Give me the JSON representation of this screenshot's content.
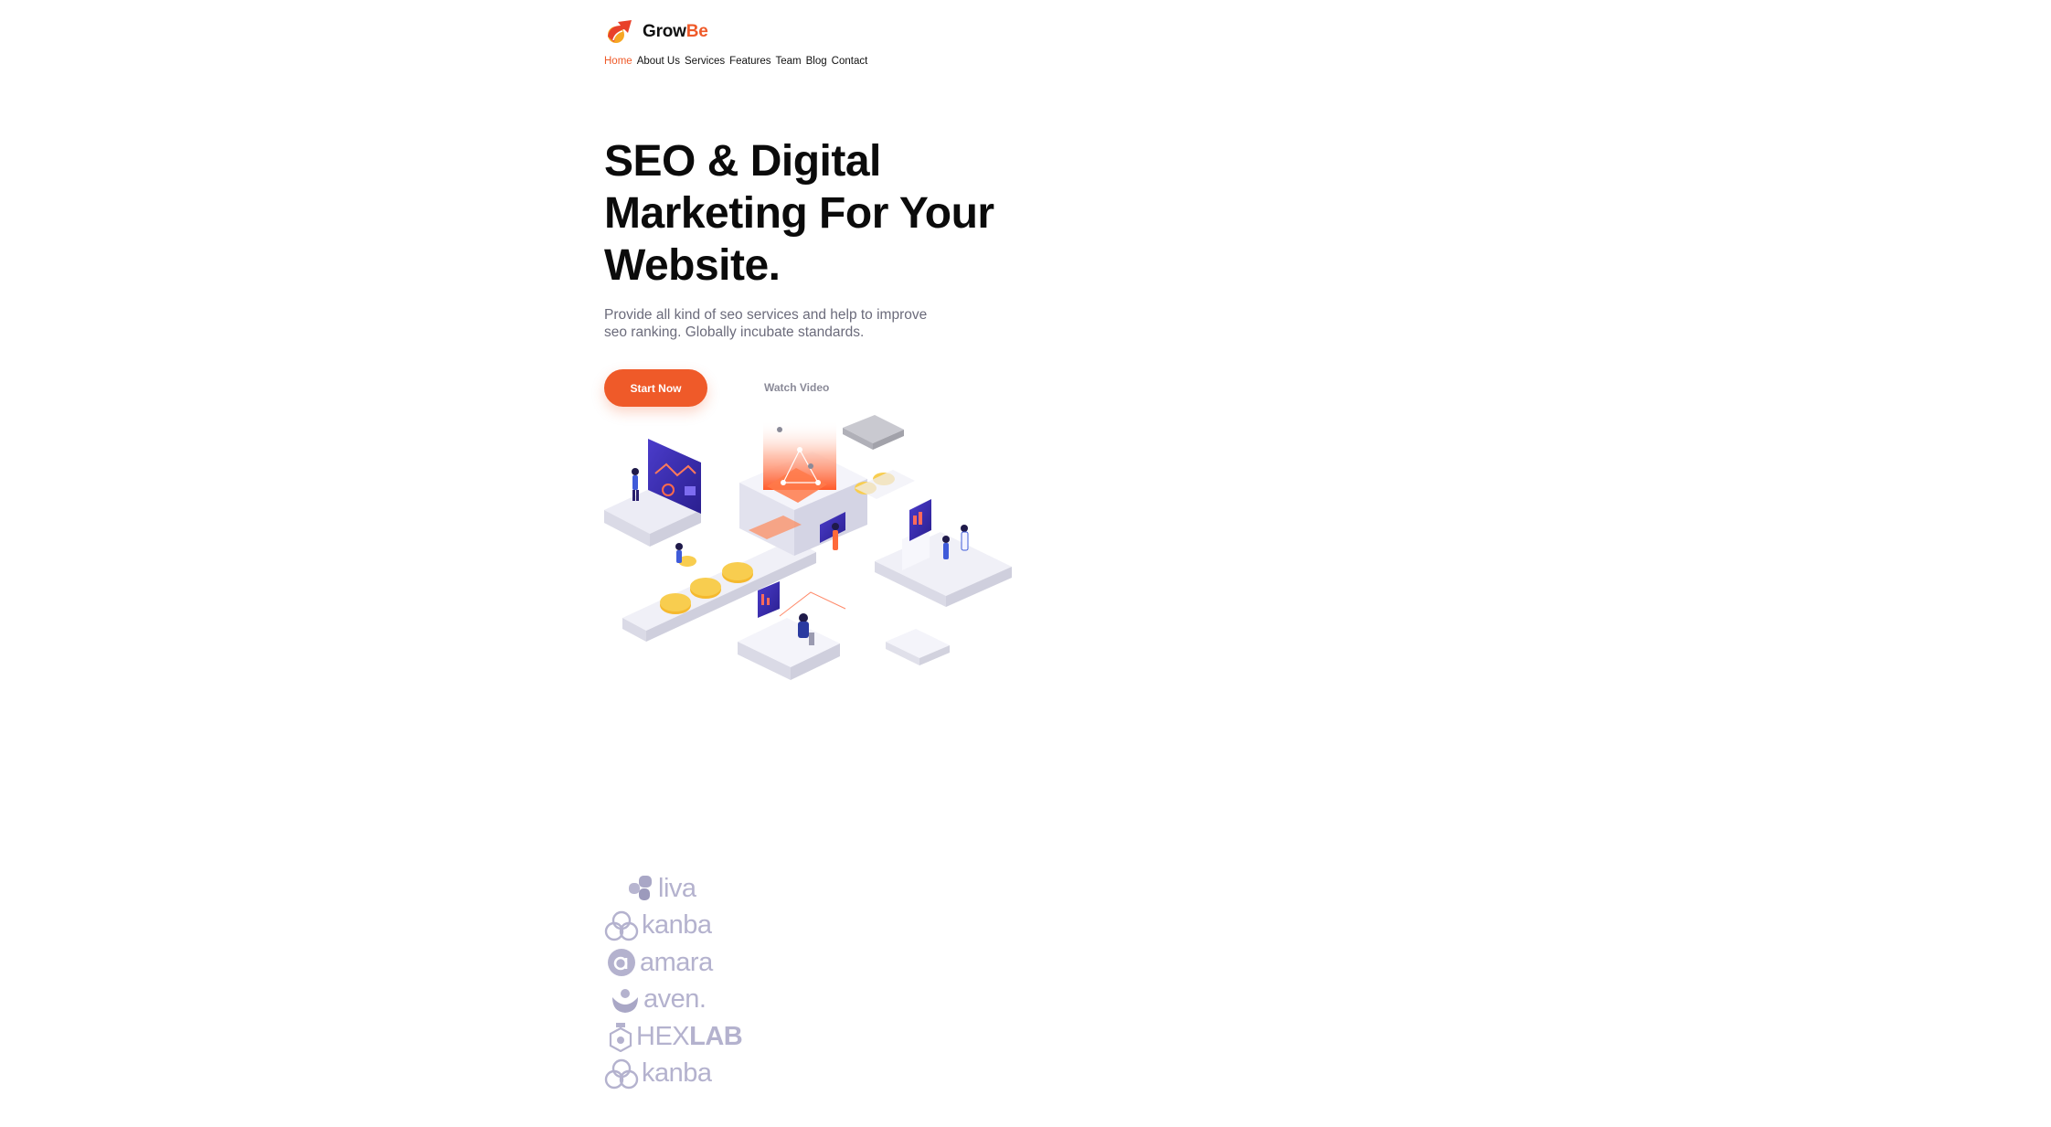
{
  "header": {
    "logo_icon": "growbe-rocket-icon",
    "logo_prefix": "Grow",
    "logo_suffix": "Be",
    "nav": [
      {
        "label": "Home",
        "active": true
      },
      {
        "label": "About Us",
        "active": false
      },
      {
        "label": "Services",
        "active": false
      },
      {
        "label": "Features",
        "active": false
      },
      {
        "label": "Team",
        "active": false
      },
      {
        "label": "Blog",
        "active": false
      },
      {
        "label": "Contact",
        "active": false
      }
    ]
  },
  "hero": {
    "title_line1": "SEO & Digital",
    "title_line2": "Marketing For Your",
    "title_line3": "Website.",
    "description_line1": "Provide all kind of seo services and help to improve",
    "description_line2": "seo ranking. Globally incubate standards.",
    "primary_button": "Start Now",
    "secondary_button": "Watch Video",
    "illustration_icon": "isometric-seo-illustration"
  },
  "brands": [
    {
      "icon": "liva-logo-icon",
      "name": "liva"
    },
    {
      "icon": "kanba-logo-icon",
      "name": "kanba"
    },
    {
      "icon": "amara-logo-icon",
      "name": "amara"
    },
    {
      "icon": "aven-logo-icon",
      "name": "aven."
    },
    {
      "icon": "hexlab-logo-icon",
      "name_light": "HEX",
      "name_bold": "LAB"
    },
    {
      "icon": "kanba-logo-icon",
      "name": "kanba"
    }
  ],
  "colors": {
    "accent": "#ef5a29",
    "text": "#0b0b0b",
    "muted": "#6b6b7b",
    "brand_gray": "#b4b2ce"
  }
}
